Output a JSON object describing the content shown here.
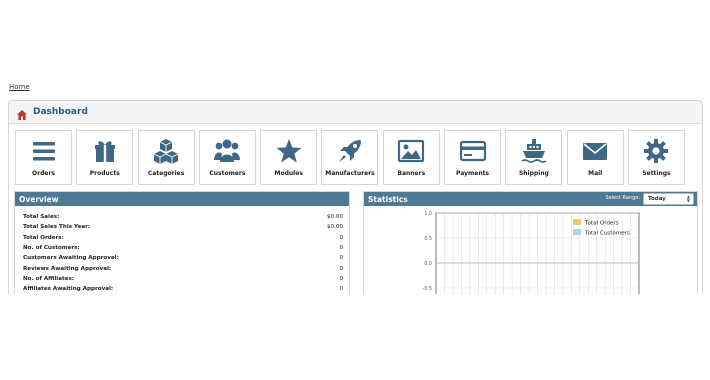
{
  "breadcrumb": "Home",
  "header": {
    "title": "Dashboard"
  },
  "tiles": [
    {
      "label": "Orders",
      "icon": "list-icon"
    },
    {
      "label": "Products",
      "icon": "gift-icon"
    },
    {
      "label": "Categories",
      "icon": "boxes-icon"
    },
    {
      "label": "Customers",
      "icon": "users-icon"
    },
    {
      "label": "Modules",
      "icon": "star-icon"
    },
    {
      "label": "Manufacturers",
      "icon": "rocket-icon"
    },
    {
      "label": "Banners",
      "icon": "picture-icon"
    },
    {
      "label": "Payments",
      "icon": "credit-card-icon"
    },
    {
      "label": "Shipping",
      "icon": "ship-icon"
    },
    {
      "label": "Mail",
      "icon": "envelope-icon"
    },
    {
      "label": "Settings",
      "icon": "gear-icon"
    }
  ],
  "overview": {
    "title": "Overview",
    "rows": [
      {
        "label": "Total Sales:",
        "value": "$0.00"
      },
      {
        "label": "Total Sales This Year:",
        "value": "$0.00"
      },
      {
        "label": "Total Orders:",
        "value": "0"
      },
      {
        "label": "No. of Customers:",
        "value": "0"
      },
      {
        "label": "Customers Awaiting Approval:",
        "value": "0"
      },
      {
        "label": "Reviews Awaiting Approval:",
        "value": "0"
      },
      {
        "label": "No. of Affiliates:",
        "value": "0"
      },
      {
        "label": "Affiliates Awaiting Approval:",
        "value": "0"
      }
    ]
  },
  "statistics": {
    "title": "Statistics",
    "range_label": "Select Range:",
    "range_value": "Today"
  },
  "chart_data": {
    "type": "line",
    "x": [],
    "series": [
      {
        "name": "Total Orders",
        "color": "#f0c96b",
        "values": []
      },
      {
        "name": "Total Customers",
        "color": "#b2d1ea",
        "values": []
      }
    ],
    "yticks": [
      "1.0",
      "0.5",
      "0.0",
      "-0.5"
    ],
    "ylim": [
      -1.0,
      1.0
    ],
    "grid": true,
    "legend": "top-right"
  },
  "colors": {
    "accent": "#4f7894",
    "title": "#2e5b7c",
    "icon": "#3f6886"
  }
}
